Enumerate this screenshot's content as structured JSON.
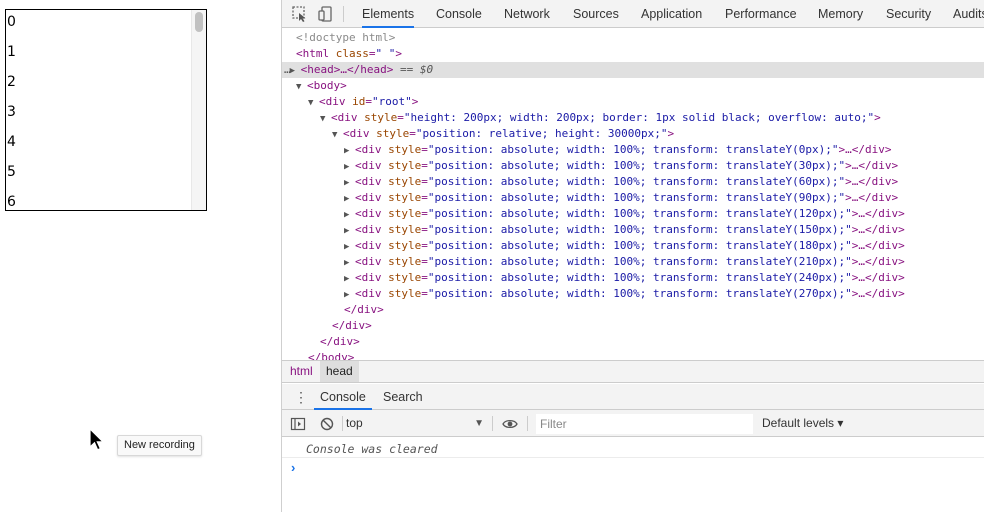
{
  "page": {
    "virtual_list_rows": [
      "0",
      "1",
      "2",
      "3",
      "4",
      "5",
      "6"
    ],
    "tooltip": "New recording"
  },
  "devtools": {
    "tabs": [
      "Elements",
      "Console",
      "Network",
      "Sources",
      "Application",
      "Performance",
      "Memory",
      "Security",
      "Audits"
    ],
    "active_tab": "Elements",
    "dom_tree": {
      "doctype": "<!doctype html>",
      "html_open": "<html",
      "html_attr": "class",
      "html_val": "\" \"",
      "head_collapsed": "<head>…</head>",
      "selected_marker": "== $0",
      "body_open": "<body>",
      "root_div": {
        "tag": "<div",
        "attr": "id",
        "val": "\"root\""
      },
      "outer_div": {
        "tag": "<div",
        "attr": "style",
        "val": "\"height: 200px; width: 200px; border: 1px solid black; overflow: auto;\""
      },
      "inner_div": {
        "tag": "<div",
        "attr": "style",
        "val": "\"position: relative; height: 30000px;\""
      },
      "row_divs": [
        {
          "attr": "style",
          "val": "\"position: absolute; width: 100%; transform: translateY(0px);\""
        },
        {
          "attr": "style",
          "val": "\"position: absolute; width: 100%; transform: translateY(30px);\""
        },
        {
          "attr": "style",
          "val": "\"position: absolute; width: 100%; transform: translateY(60px);\""
        },
        {
          "attr": "style",
          "val": "\"position: absolute; width: 100%; transform: translateY(90px);\""
        },
        {
          "attr": "style",
          "val": "\"position: absolute; width: 100%; transform: translateY(120px);\""
        },
        {
          "attr": "style",
          "val": "\"position: absolute; width: 100%; transform: translateY(150px);\""
        },
        {
          "attr": "style",
          "val": "\"position: absolute; width: 100%; transform: translateY(180px);\""
        },
        {
          "attr": "style",
          "val": "\"position: absolute; width: 100%; transform: translateY(210px);\""
        },
        {
          "attr": "style",
          "val": "\"position: absolute; width: 100%; transform: translateY(240px);\""
        },
        {
          "attr": "style",
          "val": "\"position: absolute; width: 100%; transform: translateY(270px);\""
        }
      ],
      "row_close": "…</div>",
      "div_close": "</div>",
      "body_close": "</body>"
    },
    "breadcrumbs": [
      "html",
      "head"
    ],
    "drawer_tabs": [
      "Console",
      "Search"
    ],
    "console": {
      "context": "top",
      "filter_placeholder": "Filter",
      "levels": "Default levels ▾",
      "cleared_message": "Console was cleared",
      "prompt": "›"
    }
  }
}
